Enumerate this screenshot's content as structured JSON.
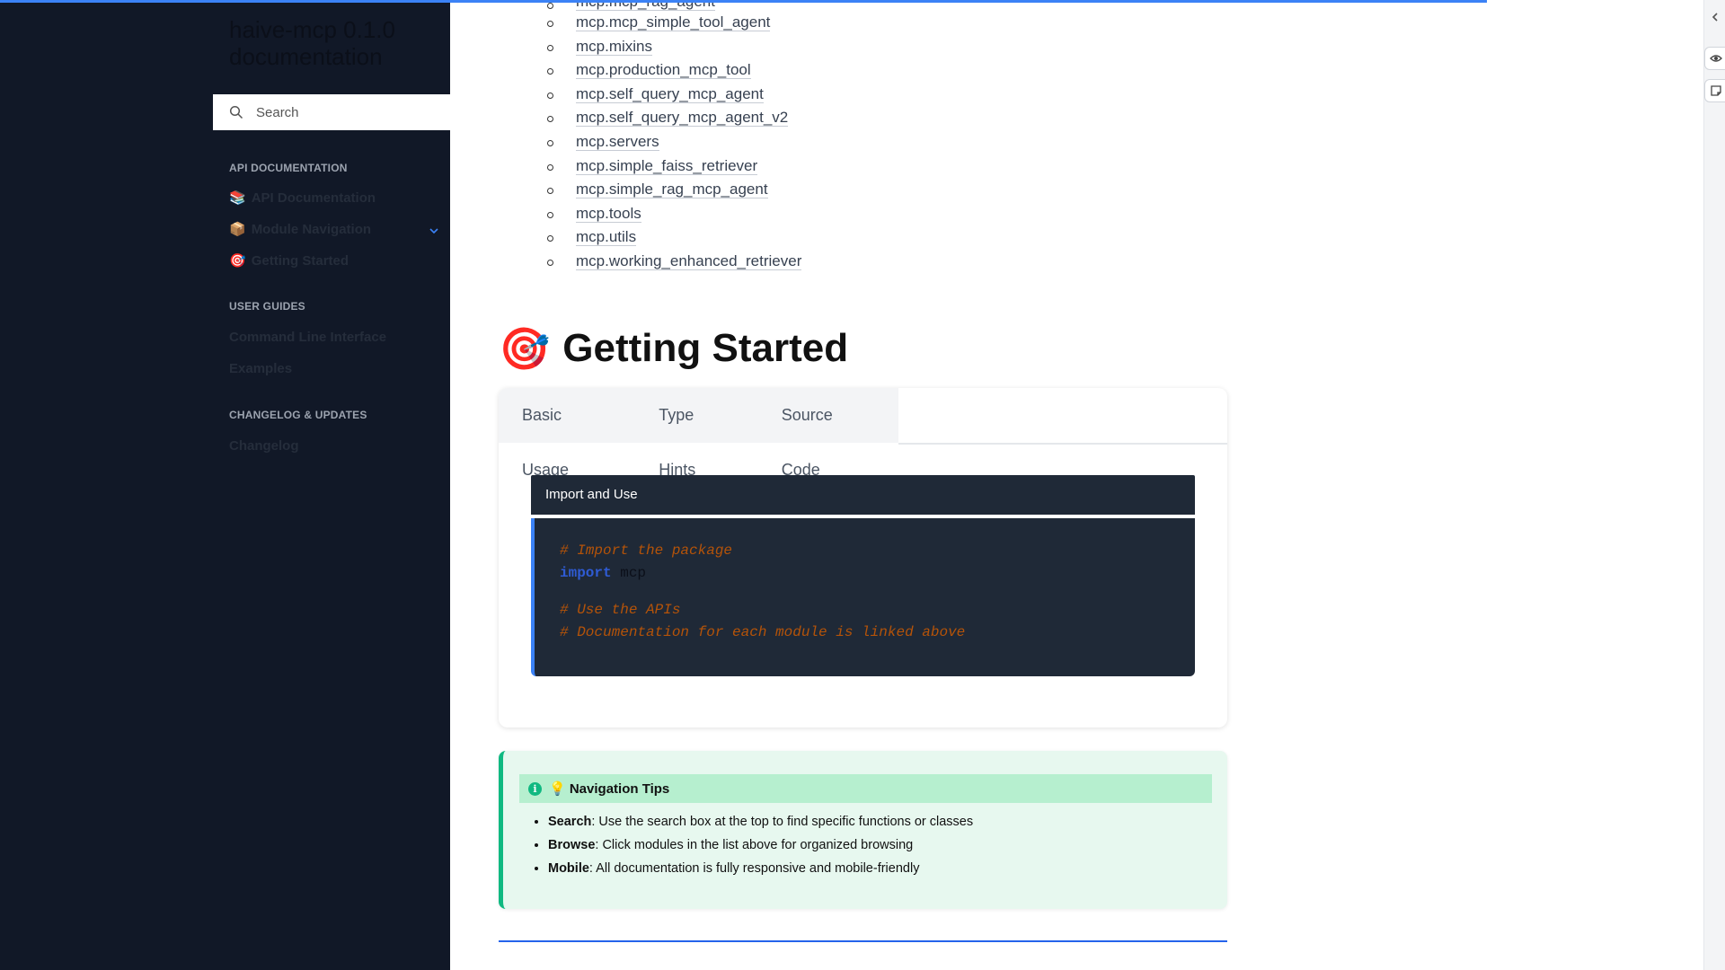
{
  "sidebar": {
    "title": "haive-mcp 0.1.0 documentation",
    "search": {
      "placeholder": "Search"
    },
    "sections": [
      {
        "label": "API DOCUMENTATION"
      },
      {
        "label": "USER GUIDES"
      },
      {
        "label": "CHANGELOG & UPDATES"
      }
    ],
    "api_items": [
      {
        "emoji": "📚",
        "label": "API Documentation"
      },
      {
        "emoji": "📦",
        "label": "Module Navigation"
      },
      {
        "emoji": "🎯",
        "label": "Getting Started"
      }
    ],
    "guide_items": [
      "Command Line Interface",
      "Examples"
    ],
    "changelog_items": [
      "Changelog"
    ]
  },
  "main": {
    "modules": [
      "mcp.mcp_simple_tool_agent",
      "mcp.mixins",
      "mcp.production_mcp_tool",
      "mcp.self_query_mcp_agent",
      "mcp.self_query_mcp_agent_v2",
      "mcp.servers",
      "mcp.simple_faiss_retriever",
      "mcp.simple_rag_mcp_agent",
      "mcp.tools",
      "mcp.utils",
      "mcp.working_enhanced_retriever"
    ],
    "heading": {
      "emoji": "🎯",
      "text": "Getting Started"
    },
    "tabs": [
      "Basic Usage",
      "Type Hints",
      "Source Code"
    ],
    "code": {
      "title": "Import and Use",
      "line1": "# Import the package",
      "kw": "import",
      "mod": "mcp",
      "line3": "# Use the APIs",
      "line4": "# Documentation for each module is linked above"
    },
    "tips": {
      "title": "💡 Navigation Tips",
      "items": [
        {
          "term": "Search",
          "text": ": Use the search box at the top to find specific functions or classes"
        },
        {
          "term": "Browse",
          "text": ": Click modules in the list above for organized browsing"
        },
        {
          "term": "Mobile",
          "text": ": All documentation is fully responsive and mobile-friendly"
        }
      ]
    }
  },
  "colors": {
    "sidebar_bg": "#111827",
    "accent": "#3b82f6",
    "tips_green": "#10b981"
  },
  "icons": [
    "search-icon",
    "chevron-down-icon",
    "collapse-arrow-icon",
    "eye-icon",
    "note-icon",
    "info-icon"
  ]
}
